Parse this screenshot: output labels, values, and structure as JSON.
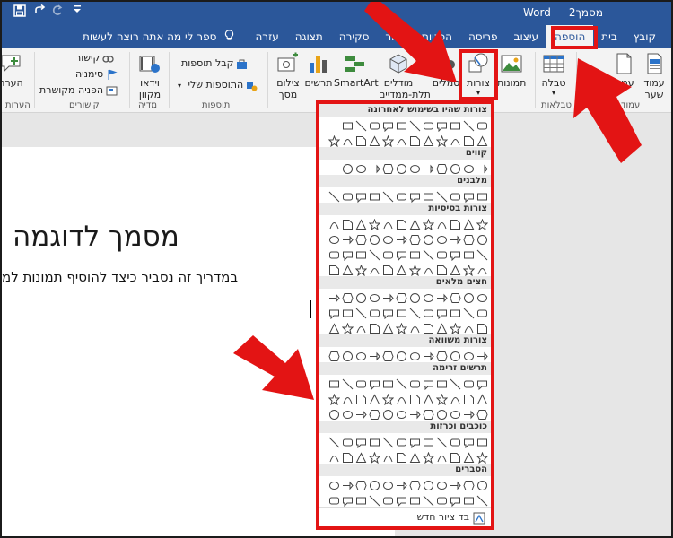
{
  "titlebar": {
    "app": "Word",
    "doc": "מסמך2",
    "sep": "-"
  },
  "tabs": [
    "קובץ",
    "בית",
    "הוספה",
    "עיצוב",
    "פריסה",
    "הפניות",
    "דיוור",
    "סקירה",
    "תצוגה",
    "עזרה"
  ],
  "tell_me": "ספר לי מה אתה רוצה לעשות",
  "ribbon": {
    "cover": "עמוד",
    "cover2": "שער",
    "blank": "עמוד",
    "table": "טבלה",
    "tables_group": "טבלאות",
    "pictures": "תמונות",
    "shapes": "צורות",
    "icons": "סמלים",
    "models": "מודלים",
    "models2": "תלת-ממדיים",
    "smartart": "SmartArt",
    "chart": "תרשים",
    "screenshot": "צילום",
    "screenshot2": "מסך",
    "get_addins": "קבל תוספות",
    "my_addins": "התוספות שלי",
    "addins_group": "תוספות",
    "video": "וידאו",
    "video2": "מקוון",
    "media_group": "מדיה",
    "link": "קישור",
    "bookmark": "סימניה",
    "crossref": "הפניה מקושרת",
    "links_group": "קישורים",
    "comment": "הערה",
    "comments_group": "הערות"
  },
  "document": {
    "title": "מסמך לדוגמה",
    "body": "במדריך זה נסביר כיצד להוסיף תמונות למ"
  },
  "gallery": {
    "sections": [
      "צורות שהיו בשימוש לאחרונה",
      "קווים",
      "מלבנים",
      "צורות בסיסיות",
      "חצים מלאים",
      "צורות משוואה",
      "תרשים זרימה",
      "כוכבים וכרזות",
      "הסברים"
    ],
    "footer": "בד ציור חדש"
  },
  "colors": {
    "title_bar": "#2b579a",
    "highlight": "#e31414"
  }
}
